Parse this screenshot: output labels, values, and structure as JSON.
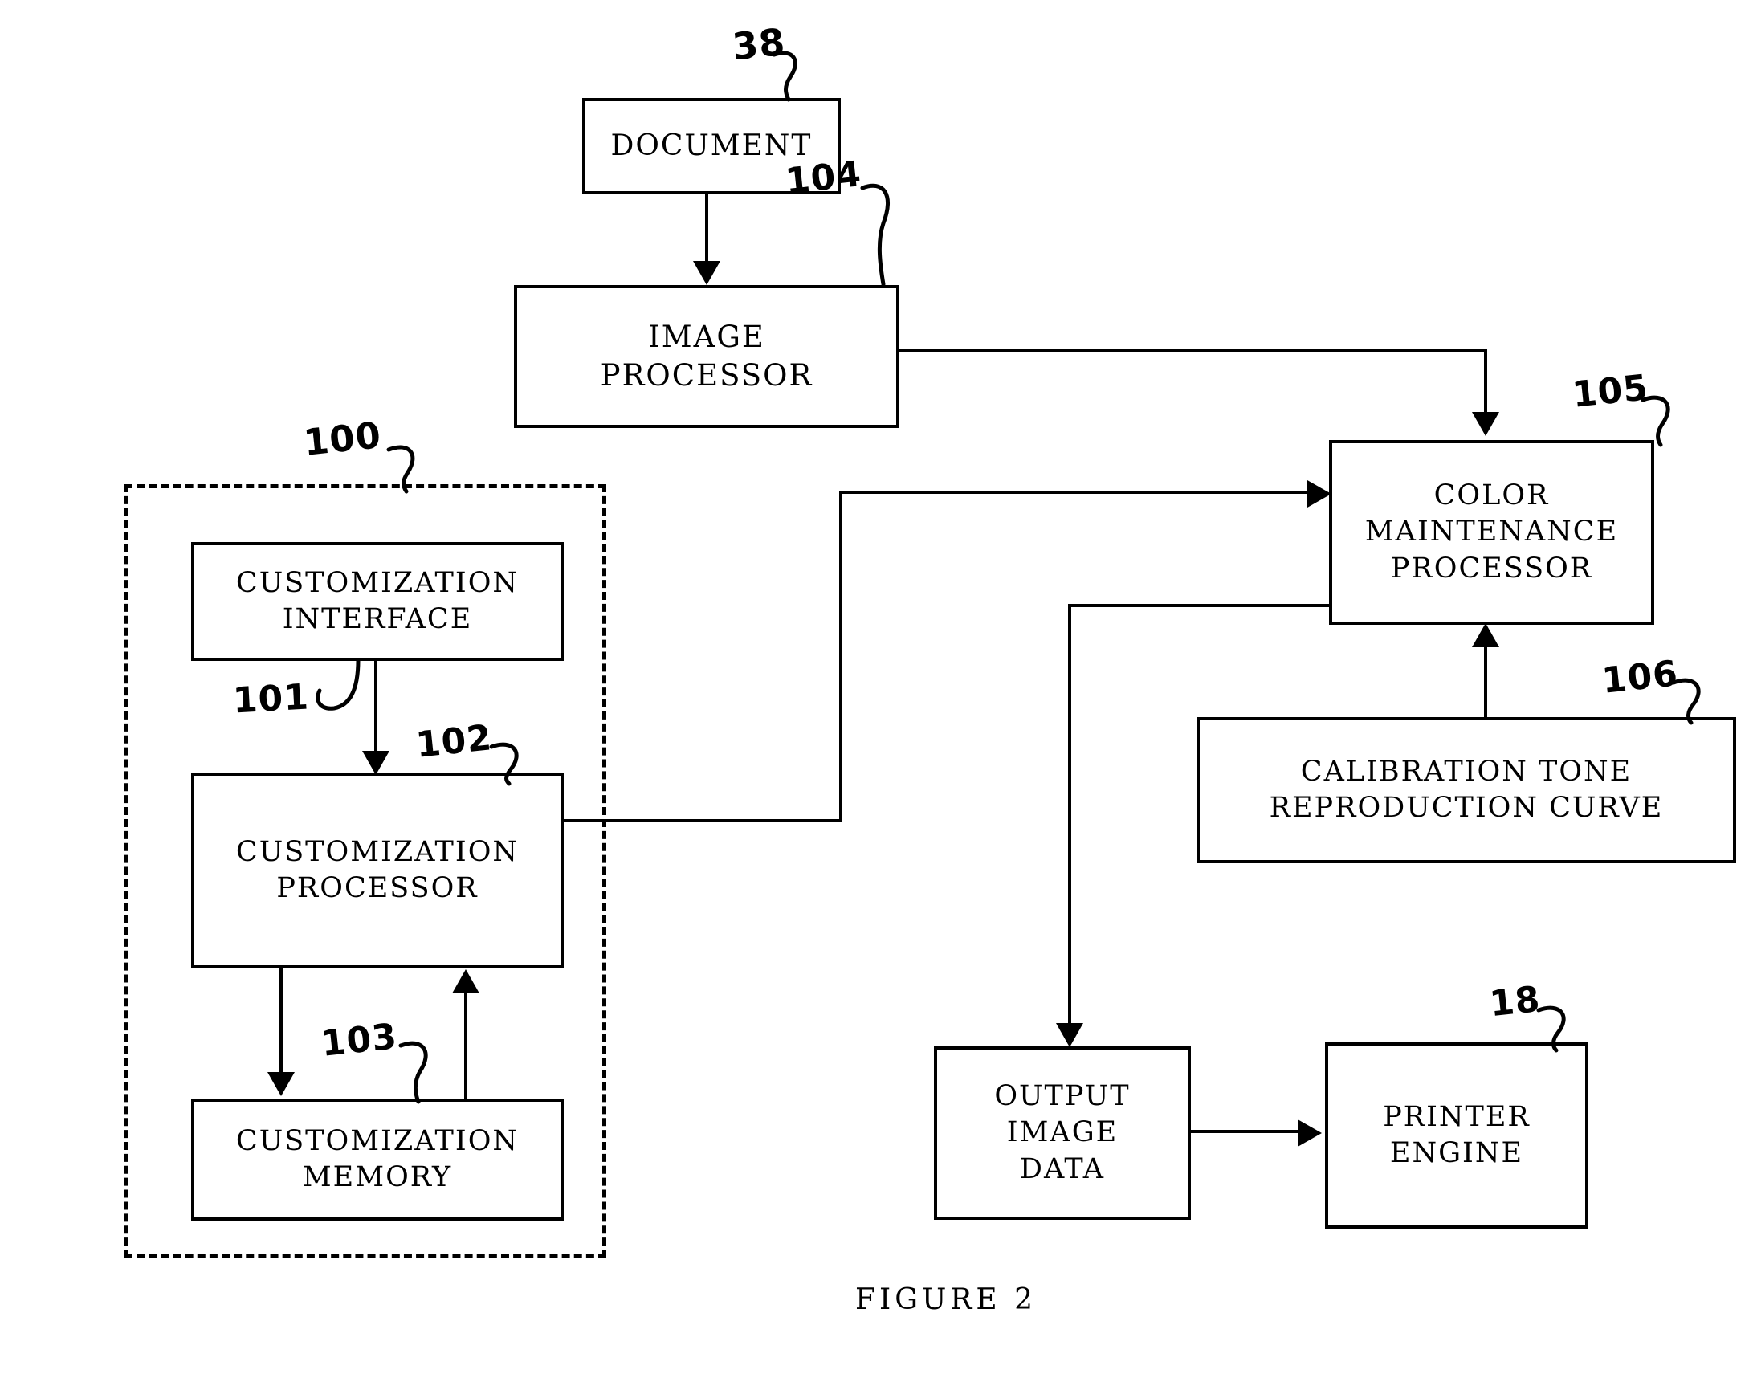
{
  "figure": {
    "caption": "FIGURE  2"
  },
  "boxes": {
    "document": {
      "line1": "DOCUMENT",
      "ref": "38"
    },
    "image_processor": {
      "line1": "IMAGE",
      "line2": "PROCESSOR",
      "ref": "104"
    },
    "customization_group": {
      "ref": "100"
    },
    "customization_interface": {
      "line1": "CUSTOMIZATION",
      "line2": "INTERFACE",
      "ref": "101"
    },
    "customization_processor": {
      "line1": "CUSTOMIZATION",
      "line2": "PROCESSOR",
      "ref": "102"
    },
    "customization_memory": {
      "line1": "CUSTOMIZATION",
      "line2": "MEMORY",
      "ref": "103"
    },
    "color_maintenance_processor": {
      "line1": "COLOR",
      "line2": "MAINTENANCE",
      "line3": "PROCESSOR",
      "ref": "105"
    },
    "calibration_trc": {
      "line1": "CALIBRATION  TONE",
      "line2": "REPRODUCTION  CURVE",
      "ref": "106"
    },
    "output_image_data": {
      "line1": "OUTPUT",
      "line2": "IMAGE",
      "line3": "DATA"
    },
    "printer_engine": {
      "line1": "PRINTER",
      "line2": "ENGINE",
      "ref": "18"
    }
  },
  "colors": {
    "ink": "#000000",
    "paper": "#ffffff"
  }
}
